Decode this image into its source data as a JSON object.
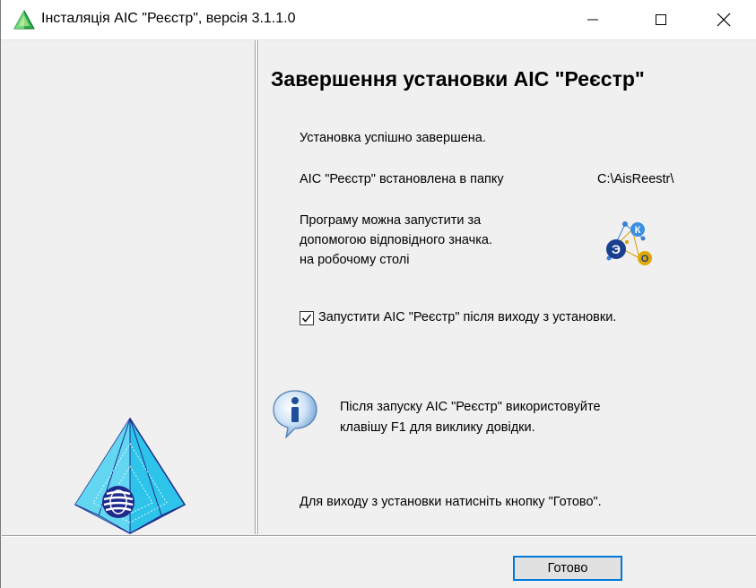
{
  "window": {
    "title": "Інсталяція АІС \"Реєстр\", версія 3.1.1.0",
    "icon": "green-triangle-icon",
    "controls": [
      "minimize-icon",
      "maximize-icon",
      "close-icon"
    ]
  },
  "main": {
    "heading": "Завершення установки АІС \"Реєстр\"",
    "success_text": "Установка успішно завершена.",
    "installed_label": "АІС \"Реєстр\" встановлена в папку",
    "install_path": "C:\\AisReestr\\",
    "launch_hint": [
      "Програму можна запустити за",
      "допомогою відповідного значка.",
      "на робочому столі"
    ],
    "launch_checkbox": {
      "checked": true,
      "label": "Запустити АІС \"Реєстр\" після виходу з установки."
    },
    "help_note": [
      "Після запуску АІС \"Реєстр\" використовуйте",
      "клавішу F1 для виклику довідки."
    ],
    "exit_hint": "Для виходу з установки натисніть кнопку \"Готово\"."
  },
  "footer": {
    "finish_label": "Готово"
  },
  "colors": {
    "accent": "#0078d7",
    "panel_bg": "#f0f0f0",
    "pyramid": "#33ccee"
  }
}
